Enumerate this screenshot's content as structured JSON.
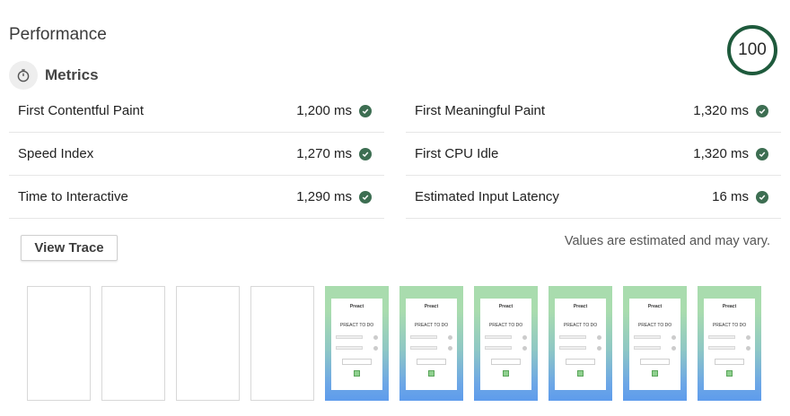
{
  "title": "Performance",
  "score": "100",
  "metrics_title": "Metrics",
  "metrics_icon": "stopwatch-icon",
  "metrics": [
    {
      "label": "First Contentful Paint",
      "value": "1,200 ms",
      "status": "pass"
    },
    {
      "label": "First Meaningful Paint",
      "value": "1,320 ms",
      "status": "pass"
    },
    {
      "label": "Speed Index",
      "value": "1,270 ms",
      "status": "pass"
    },
    {
      "label": "First CPU Idle",
      "value": "1,320 ms",
      "status": "pass"
    },
    {
      "label": "Time to Interactive",
      "value": "1,290 ms",
      "status": "pass"
    },
    {
      "label": "Estimated Input Latency",
      "value": "16 ms",
      "status": "pass"
    }
  ],
  "view_trace_label": "View Trace",
  "note": "Values are estimated and may vary.",
  "filmstrip": {
    "frame_states": [
      "blank",
      "blank",
      "blank",
      "blank",
      "loaded",
      "loaded",
      "loaded",
      "loaded",
      "loaded",
      "loaded"
    ],
    "app_title": "Preact",
    "app_heading": "PREACT TO DO"
  },
  "colors": {
    "pass": "#3d6e52",
    "score_ring": "#1e5a3c"
  }
}
